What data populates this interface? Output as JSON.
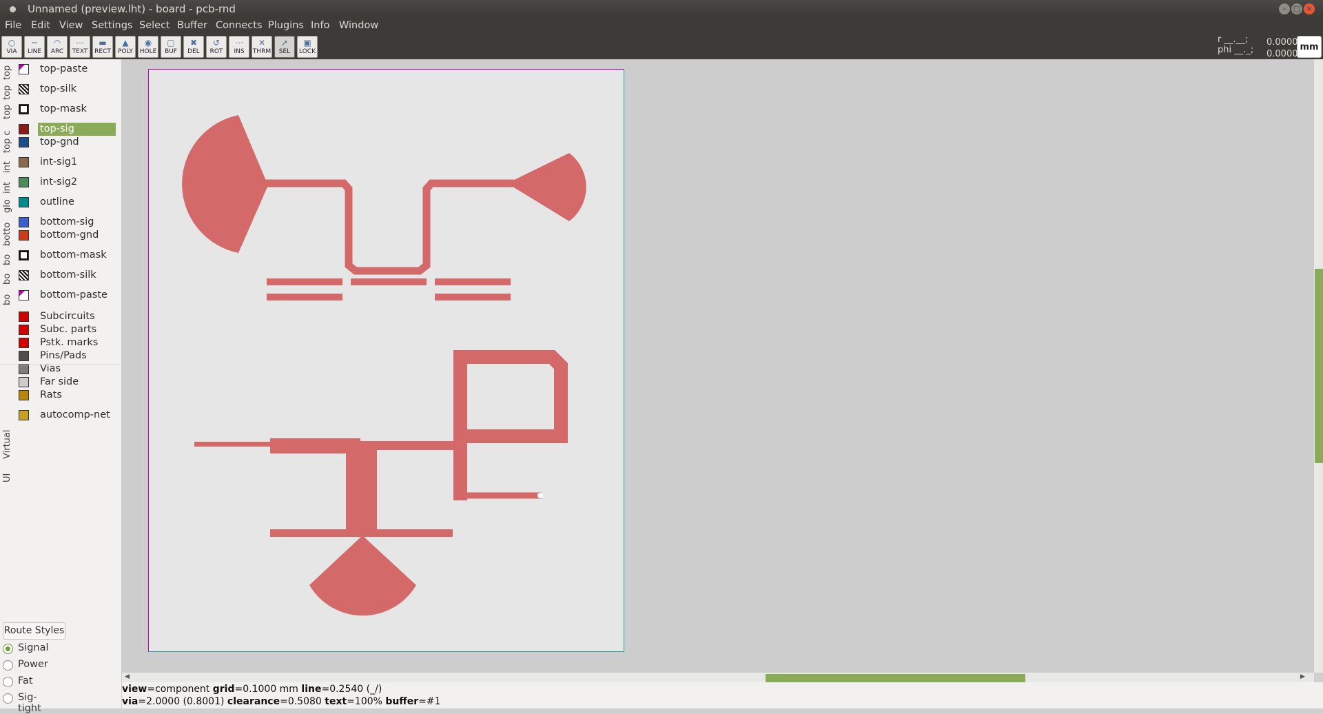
{
  "window": {
    "title": "Unnamed (preview.lht) - board - pcb-rnd"
  },
  "menu": [
    "File",
    "Edit",
    "View",
    "Settings",
    "Select",
    "Buffer",
    "Connects",
    "Plugins",
    "Info",
    "Window"
  ],
  "toolbar": [
    {
      "label": "VIA",
      "icon": "via-icon"
    },
    {
      "label": "LINE",
      "icon": "line-icon"
    },
    {
      "label": "ARC",
      "icon": "arc-icon"
    },
    {
      "label": "TEXT",
      "icon": "text-icon"
    },
    {
      "label": "RECT",
      "icon": "rect-icon"
    },
    {
      "label": "POLY",
      "icon": "poly-icon"
    },
    {
      "label": "HOLE",
      "icon": "hole-icon"
    },
    {
      "label": "BUF",
      "icon": "buffer-icon"
    },
    {
      "label": "DEL",
      "icon": "delete-icon"
    },
    {
      "label": "ROT",
      "icon": "rotate-icon"
    },
    {
      "label": "INS",
      "icon": "insert-icon"
    },
    {
      "label": "THRM",
      "icon": "thermal-icon"
    },
    {
      "label": "SEL",
      "icon": "select-icon",
      "active": true
    },
    {
      "label": "LOCK",
      "icon": "lock-icon"
    }
  ],
  "coords": {
    "r_label": "r __.__;",
    "phi_label": "phi __._;",
    "extra_label": "__._ __._ __",
    "x": "0.0000",
    "y": "0.0000",
    "units": "mm"
  },
  "layer_groups": [
    "top",
    "top",
    "top",
    "top c",
    "int",
    "int",
    "glo",
    "botto",
    "bo",
    "bo",
    "bo",
    "Virtual",
    "UI"
  ],
  "layers": [
    {
      "name": "top-paste",
      "color": "#ffffff",
      "pattern": "corner"
    },
    {
      "name": "top-silk",
      "color": "#000000",
      "pattern": "hatch"
    },
    {
      "name": "top-mask",
      "color": "#ffffff",
      "pattern": "boxed"
    },
    {
      "name": "top-sig",
      "color": "#8b1a1a",
      "selected": true
    },
    {
      "name": "top-gnd",
      "color": "#1a4f8b"
    },
    {
      "name": "int-sig1",
      "color": "#8b6a4a"
    },
    {
      "name": "int-sig2",
      "color": "#4a8b5a"
    },
    {
      "name": "outline",
      "color": "#008b8b"
    },
    {
      "name": "bottom-sig",
      "color": "#3a5fcf"
    },
    {
      "name": "bottom-gnd",
      "color": "#cf3a1a"
    },
    {
      "name": "bottom-mask",
      "color": "#ffffff",
      "pattern": "boxed"
    },
    {
      "name": "bottom-silk",
      "color": "#000000",
      "pattern": "hatch"
    },
    {
      "name": "bottom-paste",
      "color": "#ffffff",
      "pattern": "corner"
    },
    {
      "name": "Subcircuits",
      "color": "#d00000"
    },
    {
      "name": "Subc. parts",
      "color": "#d00000"
    },
    {
      "name": "Pstk. marks",
      "color": "#d00000"
    },
    {
      "name": "Pins/Pads",
      "color": "#4d4d4d"
    },
    {
      "name": "Vias",
      "color": "#7d7d7d"
    },
    {
      "name": "Far side",
      "color": "#cccccc"
    },
    {
      "name": "Rats",
      "color": "#b8860b"
    },
    {
      "name": "autocomp-net",
      "color": "#c8a020"
    }
  ],
  "route_styles": {
    "button": "Route Styles",
    "items": [
      {
        "name": "Signal",
        "selected": true
      },
      {
        "name": "Power"
      },
      {
        "name": "Fat"
      },
      {
        "name": "Sig-tight"
      }
    ]
  },
  "status": {
    "line1": {
      "view": "component",
      "grid": "0.1000 mm",
      "line": "0.2540 (_/)"
    },
    "line2": {
      "via": "2.0000 (0.8001)",
      "clearance": "0.5080",
      "text": "100%",
      "buffer": "#1"
    }
  },
  "colors": {
    "copper": "#d4696a",
    "accent": "#8aab57"
  }
}
